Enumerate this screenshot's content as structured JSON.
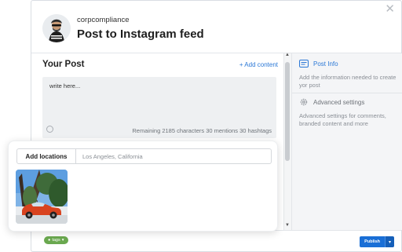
{
  "header": {
    "account": "corpcompliance",
    "title": "Post to Instagram feed"
  },
  "editor": {
    "heading": "Your Post",
    "add_content": "+ Add content",
    "placeholder": "write here...",
    "remaining": "Remaining 2185 characters 30 mentions 30 hashtags"
  },
  "sidebar": {
    "post_info": {
      "label": "Post Info",
      "description": "Add the information needed to create yor post",
      "color": "#2b78d6"
    },
    "advanced": {
      "label": "Advanced settings",
      "description": "Advanced settings for comments, branded content and more"
    }
  },
  "locations": {
    "button": "Add locations",
    "placeholder": "Los Angeles, California"
  },
  "footer": {
    "tag_label": "tags",
    "publish_label": "Publish",
    "accent": "#1a6fd6"
  }
}
